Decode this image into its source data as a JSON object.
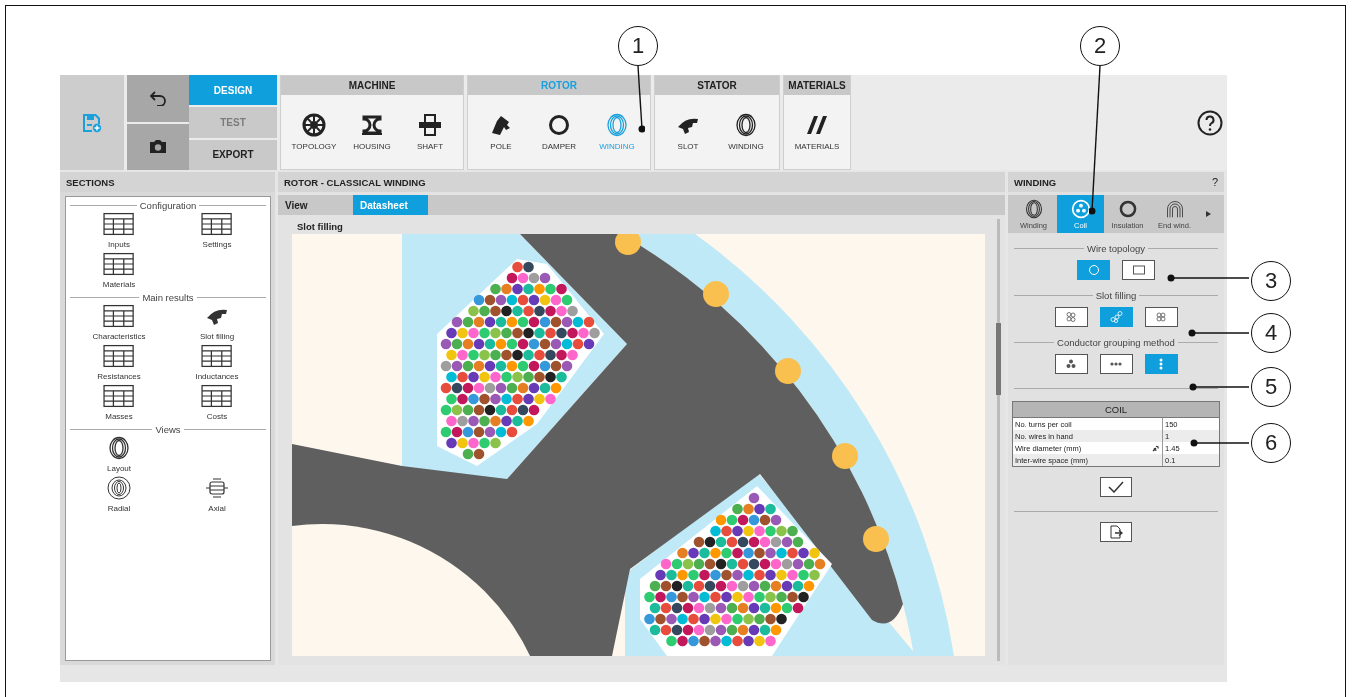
{
  "modes": [
    {
      "label": "DESIGN",
      "selected": true,
      "disabled": false
    },
    {
      "label": "TEST",
      "selected": false,
      "disabled": true
    },
    {
      "label": "EXPORT",
      "selected": false,
      "disabled": false
    }
  ],
  "groups": [
    {
      "title": "MACHINE",
      "active": false,
      "items": [
        {
          "label": "TOPOLOGY",
          "kind": "topology",
          "selected": false
        },
        {
          "label": "HOUSING",
          "kind": "housing",
          "selected": false
        },
        {
          "label": "SHAFT",
          "kind": "shaft",
          "selected": false
        }
      ]
    },
    {
      "title": "ROTOR",
      "active": true,
      "items": [
        {
          "label": "POLE",
          "kind": "pole",
          "selected": false
        },
        {
          "label": "DAMPER",
          "kind": "damper",
          "selected": false
        },
        {
          "label": "WINDING",
          "kind": "winding",
          "selected": true
        }
      ]
    },
    {
      "title": "STATOR",
      "active": false,
      "items": [
        {
          "label": "SLOT",
          "kind": "slot",
          "selected": false
        },
        {
          "label": "WINDING",
          "kind": "winding",
          "selected": false
        }
      ]
    },
    {
      "title": "MATERIALS",
      "active": false,
      "items": [
        {
          "label": "MATERIALS",
          "kind": "materials",
          "selected": false
        }
      ]
    }
  ],
  "sections": {
    "title": "SECTIONS",
    "groups": [
      {
        "title": "Configuration",
        "rows": [
          [
            {
              "label": "Inputs",
              "kind": "table"
            },
            {
              "label": "Settings",
              "kind": "table"
            }
          ],
          [
            {
              "label": "Materials",
              "kind": "table"
            }
          ]
        ]
      },
      {
        "title": "Main results",
        "rows": [
          [
            {
              "label": "Characteristics",
              "kind": "table"
            },
            {
              "label": "Slot filling",
              "kind": "slot"
            }
          ],
          [
            {
              "label": "Resistances",
              "kind": "table"
            },
            {
              "label": "Inductances",
              "kind": "table"
            }
          ],
          [
            {
              "label": "Masses",
              "kind": "table"
            },
            {
              "label": "Costs",
              "kind": "table"
            }
          ]
        ]
      },
      {
        "title": "Views",
        "rows": [
          [
            {
              "label": "Layout",
              "kind": "winding"
            }
          ],
          [
            {
              "label": "Radial",
              "kind": "radial"
            },
            {
              "label": "Axial",
              "kind": "axial"
            }
          ]
        ]
      }
    ]
  },
  "center": {
    "title": "ROTOR - CLASSICAL WINDING",
    "tabs": [
      {
        "label": "View",
        "selected": false
      },
      {
        "label": "Datasheet",
        "selected": true
      }
    ],
    "subtitle": "Slot filling"
  },
  "winding_panel": {
    "title": "WINDING",
    "help": "?",
    "tabs": [
      {
        "label": "Winding",
        "kind": "winding",
        "selected": false
      },
      {
        "label": "Coil",
        "kind": "coil",
        "selected": true
      },
      {
        "label": "Insulation",
        "kind": "ring",
        "selected": false
      },
      {
        "label": "End wind.",
        "kind": "endwind",
        "selected": false
      }
    ],
    "option_groups": [
      {
        "title": "Wire topology",
        "options": [
          {
            "kind": "round",
            "selected": true
          },
          {
            "kind": "rect",
            "selected": false
          }
        ]
      },
      {
        "title": "Slot filling",
        "options": [
          {
            "kind": "loose",
            "selected": false
          },
          {
            "kind": "staggered",
            "selected": true
          },
          {
            "kind": "square",
            "selected": false
          }
        ]
      },
      {
        "title": "Conductor grouping method",
        "options": [
          {
            "kind": "cluster",
            "selected": false
          },
          {
            "kind": "row",
            "selected": false
          },
          {
            "kind": "column",
            "selected": true
          }
        ]
      }
    ],
    "coil_table": {
      "title": "COIL",
      "rows": [
        {
          "label": "No. turns per coil",
          "value": "150",
          "linked": false
        },
        {
          "label": "No. wires in hand",
          "value": "1",
          "linked": false
        },
        {
          "label": "Wire diameter (mm)",
          "value": "1.45",
          "linked": true
        },
        {
          "label": "Inter-wire space (mm)",
          "value": "0.1",
          "linked": false
        }
      ]
    }
  },
  "callouts": [
    "1",
    "2",
    "3",
    "4",
    "5",
    "6"
  ]
}
